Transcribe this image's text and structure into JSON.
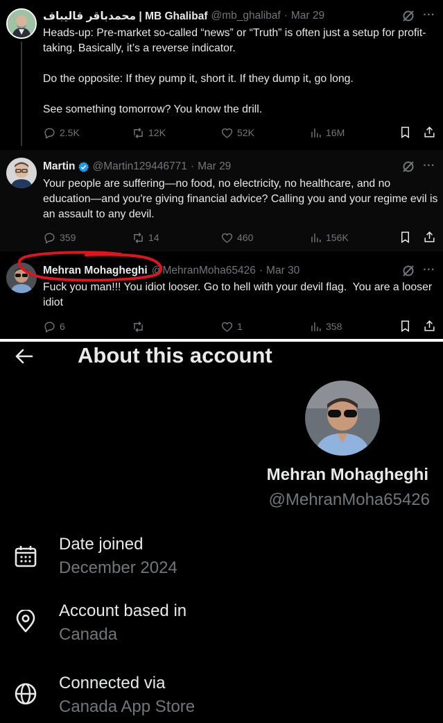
{
  "tweets": [
    {
      "display_name": "محمدباقر قالیباف | MB Ghalibaf",
      "handle": "@mb_ghalibaf",
      "date": "Mar 29",
      "body": "Heads-up: Pre-market so-called “news” or “Truth” is often just a setup for profit-taking. Basically, it’s a reverse indicator.\n\nDo the opposite: If they pump it, short it. If they dump it, go long.\n\nSee something tomorrow? You know the drill.",
      "replies": "2.5K",
      "reposts": "12K",
      "likes": "52K",
      "views": "16M"
    },
    {
      "display_name": "Martin",
      "handle": "@Martin129446771",
      "date": "Mar 29",
      "verified": true,
      "body": "Your people are suffering—no food, no electricity, no healthcare, and no education—and you're giving financial advice? Calling you and your regime evil is an assault to any devil.",
      "replies": "359",
      "reposts": "14",
      "likes": "460",
      "views": "156K"
    },
    {
      "display_name": "Mehran Mohagheghi",
      "handle": "@MehranMoha65426",
      "date": "Mar 30",
      "body": "Fuck you man!!! You idiot looser. Go to hell with your devil flag.  You are a looser idiot",
      "replies": "6",
      "reposts": "",
      "likes": "1",
      "views": "358"
    }
  ],
  "icons": {
    "reply": "reply-icon",
    "repost": "repost-icon",
    "like": "heart-icon",
    "views": "views-icon",
    "bookmark": "bookmark-icon",
    "share": "share-icon",
    "grok": "grok-icon",
    "more": "more-icon"
  },
  "about": {
    "title": "About this account",
    "display_name": "Mehran Mohagheghi",
    "handle": "@MehranMoha65426",
    "rows": [
      {
        "label": "Date joined",
        "value": "December 2024",
        "icon": "calendar-icon"
      },
      {
        "label": "Account based in",
        "value": "Canada",
        "icon": "location-pin-icon"
      },
      {
        "label": "Connected via",
        "value": "Canada App Store",
        "icon": "globe-icon"
      }
    ]
  },
  "colors": {
    "background": "#000000",
    "text_primary": "#e7e9ea",
    "text_secondary": "#71767b",
    "verified_blue": "#1d9bf0",
    "annotation_red": "#e0141e"
  }
}
